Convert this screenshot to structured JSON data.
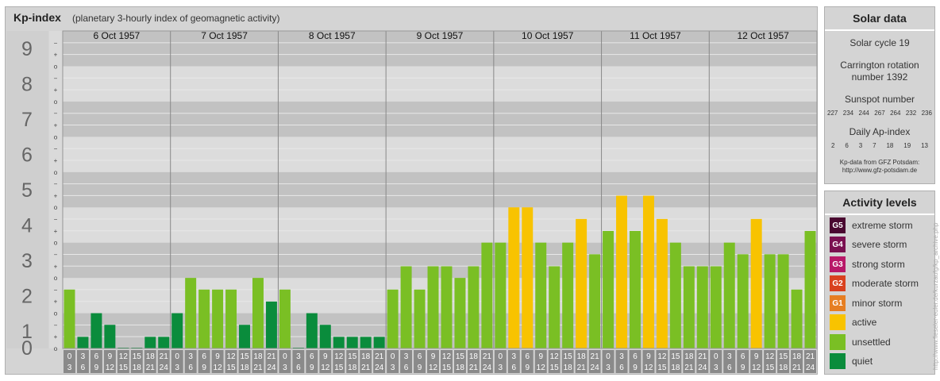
{
  "colors": {
    "quiet": "#0a8c3c",
    "unsettled": "#7abf24",
    "active": "#f8c300",
    "G1": "#e67e22",
    "G2": "#d9411e",
    "G3": "#b81868",
    "G4": "#7a1050",
    "G5": "#4a0830",
    "band_dark": "#c2c2c2",
    "band_light": "#dcdcdc",
    "time_cell": "#8a8a8a"
  },
  "chart_data": {
    "type": "bar",
    "title": "Kp-index",
    "subtitle": "(planetary 3-hourly index of geomagnetic activity)",
    "ylim": [
      0,
      9
    ],
    "y_ticks": [
      "0",
      "1",
      "2",
      "3",
      "4",
      "5",
      "6",
      "7",
      "8",
      "9"
    ],
    "minor_ticks": [
      "o",
      "+",
      "−"
    ],
    "days": [
      "6 Oct 1957",
      "7 Oct 1957",
      "8 Oct 1957",
      "9 Oct 1957",
      "10 Oct 1957",
      "11 Oct 1957",
      "12 Oct 1957"
    ],
    "interval_start": [
      "0",
      "3",
      "6",
      "9",
      "12",
      "15",
      "18",
      "21"
    ],
    "interval_end": [
      "3",
      "6",
      "9",
      "12",
      "15",
      "18",
      "21",
      "24"
    ],
    "values": [
      1.67,
      0.33,
      1.0,
      0.67,
      0.0,
      0.0,
      0.33,
      0.33,
      1.0,
      2.0,
      1.67,
      1.67,
      1.67,
      0.67,
      2.0,
      1.33,
      1.67,
      0.0,
      1.0,
      0.67,
      0.33,
      0.33,
      0.33,
      0.33,
      1.67,
      2.33,
      1.67,
      2.33,
      2.33,
      2.0,
      2.33,
      3.0,
      3.0,
      4.0,
      4.0,
      3.0,
      2.33,
      3.0,
      3.67,
      2.67,
      3.33,
      4.33,
      3.33,
      4.33,
      3.67,
      3.0,
      2.33,
      2.33,
      2.33,
      3.0,
      2.67,
      3.67,
      2.67,
      2.67,
      1.67,
      3.33
    ]
  },
  "solar_data": {
    "title": "Solar data",
    "cycle": "Solar cycle 19",
    "carrington_line1": "Carrington rotation",
    "carrington_line2": "number 1392",
    "sunspot_title": "Sunspot number",
    "sunspot_values": [
      "227",
      "234",
      "244",
      "267",
      "264",
      "232",
      "236"
    ],
    "ap_title": "Daily Ap-index",
    "ap_values": [
      "2",
      "6",
      "3",
      "7",
      "18",
      "19",
      "13"
    ],
    "source_line1": "Kp-data from GFZ Potsdam:",
    "source_line2": "http://www.gfz-potsdam.de"
  },
  "activity_levels": {
    "title": "Activity levels",
    "items": [
      {
        "badge": "G5",
        "label": "extreme storm",
        "color": "#4a0830"
      },
      {
        "badge": "G4",
        "label": "severe storm",
        "color": "#7a1050"
      },
      {
        "badge": "G3",
        "label": "strong storm",
        "color": "#b81868"
      },
      {
        "badge": "G2",
        "label": "moderate storm",
        "color": "#d9411e"
      },
      {
        "badge": "G1",
        "label": "minor storm",
        "color": "#e67e22"
      },
      {
        "badge": "",
        "label": "active",
        "color": "#f8c300"
      },
      {
        "badge": "",
        "label": "unsettled",
        "color": "#7abf24"
      },
      {
        "badge": "",
        "label": "quiet",
        "color": "#0a8c3c"
      }
    ]
  },
  "credit": "http://www.fieseler-euler.de/kurzaufg/kp_archive.php"
}
